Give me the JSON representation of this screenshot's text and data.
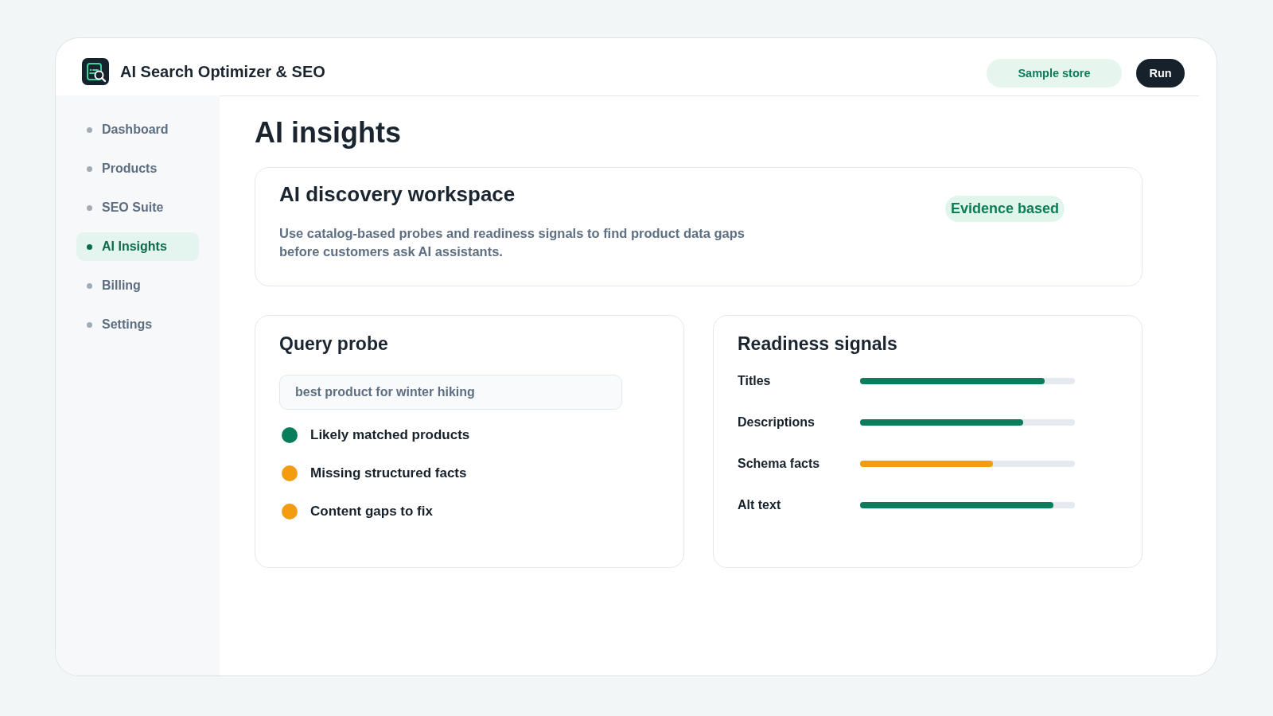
{
  "app": {
    "title": "AI Search Optimizer & SEO"
  },
  "header_actions": [
    {
      "label": "Sample store",
      "kind": "store"
    },
    {
      "label": "Run",
      "kind": "primary"
    }
  ],
  "sidebar": {
    "items": [
      {
        "label": "Dashboard",
        "selected": false
      },
      {
        "label": "Products",
        "selected": false
      },
      {
        "label": "SEO Suite",
        "selected": false
      },
      {
        "label": "AI Insights",
        "selected": true
      },
      {
        "label": "Billing",
        "selected": false
      },
      {
        "label": "Settings",
        "selected": false
      }
    ]
  },
  "page": {
    "title": "AI insights"
  },
  "workspace_card": {
    "title": "AI discovery workspace",
    "description": "Use catalog-based probes and readiness signals to find product data gaps before customers ask AI assistants.",
    "badge": "Evidence based"
  },
  "query_probe": {
    "title": "Query probe",
    "query": {
      "value": "best product for winter hiking"
    },
    "results": [
      {
        "label": "Likely matched products",
        "color": "#0a7d5c"
      },
      {
        "label": "Missing structured facts",
        "color": "#f39c0f"
      },
      {
        "label": "Content gaps to fix",
        "color": "#f39c0f"
      }
    ]
  },
  "readiness": {
    "title": "Readiness signals",
    "signals": [
      {
        "label": "Titles",
        "level": 0.86,
        "color": "#0a7d5c"
      },
      {
        "label": "Descriptions",
        "level": 0.76,
        "color": "#0a7d5c"
      },
      {
        "label": "Schema facts",
        "level": 0.62,
        "color": "#f39c0f"
      },
      {
        "label": "Alt text",
        "level": 0.9,
        "color": "#0a7d5c"
      }
    ]
  }
}
